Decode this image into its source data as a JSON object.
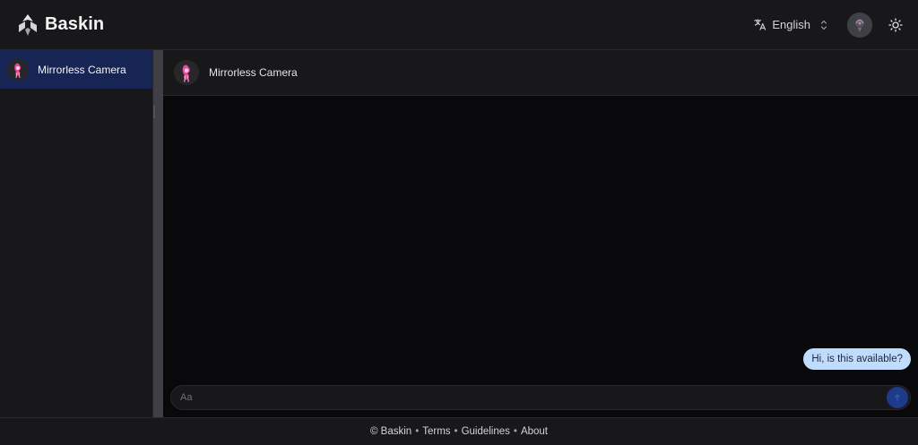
{
  "header": {
    "brand": "Baskin",
    "language": "English",
    "icons": {
      "logo": "baskin-logo-icon",
      "language": "translate-icon",
      "language_chevron": "chevron-up-down-icon",
      "theme": "sun-icon"
    }
  },
  "sidebar": {
    "conversations": [
      {
        "label": "Mirrorless Camera",
        "selected": true
      }
    ]
  },
  "chat": {
    "title": "Mirrorless Camera",
    "messages": [
      {
        "text": "Hi, is this available?",
        "from": "me"
      }
    ],
    "composer": {
      "placeholder": "Aa",
      "value": ""
    }
  },
  "footer": {
    "copyright": "© Baskin",
    "links": [
      "Terms",
      "Guidelines",
      "About"
    ],
    "separator": "•"
  },
  "colors": {
    "background": "#18181b",
    "chat_background": "#09090b",
    "selected_item": "#172554",
    "bubble": "#bfdbfe",
    "send_button": "#1e3a8a"
  }
}
